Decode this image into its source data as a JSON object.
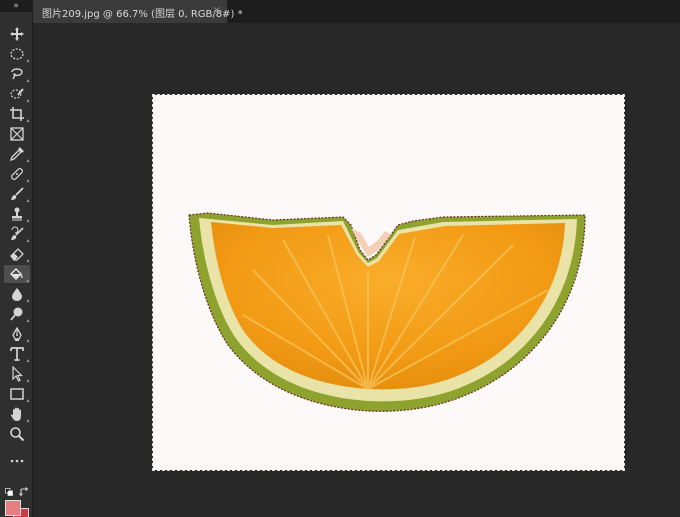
{
  "app": {
    "panel_collapse_glyph": "»"
  },
  "document_tab": {
    "title": "图片209.jpg @ 66.7% (图层 0, RGB/8#) *",
    "close_glyph": "×"
  },
  "toolbar": {
    "tools": [
      {
        "name": "move-tool",
        "icon": "move-icon"
      },
      {
        "name": "marquee-tool",
        "icon": "elliptical-marquee-icon"
      },
      {
        "name": "lasso-tool",
        "icon": "lasso-icon"
      },
      {
        "name": "quick-selection-tool",
        "icon": "quick-selection-icon"
      },
      {
        "name": "crop-tool",
        "icon": "crop-icon"
      },
      {
        "name": "frame-tool",
        "icon": "frame-icon"
      },
      {
        "name": "eyedropper-tool",
        "icon": "eyedropper-icon"
      },
      {
        "name": "healing-brush-tool",
        "icon": "bandage-icon"
      },
      {
        "name": "brush-tool",
        "icon": "brush-icon"
      },
      {
        "name": "clone-stamp-tool",
        "icon": "stamp-icon"
      },
      {
        "name": "history-brush-tool",
        "icon": "history-brush-icon"
      },
      {
        "name": "eraser-tool",
        "icon": "eraser-icon"
      },
      {
        "name": "paint-bucket-tool",
        "icon": "paint-bucket-icon",
        "active": true
      },
      {
        "name": "blur-tool",
        "icon": "drop-icon"
      },
      {
        "name": "dodge-tool",
        "icon": "dodge-icon"
      },
      {
        "name": "pen-tool",
        "icon": "pen-icon"
      },
      {
        "name": "type-tool",
        "icon": "type-icon"
      },
      {
        "name": "path-selection-tool",
        "icon": "arrow-icon"
      },
      {
        "name": "rectangle-tool",
        "icon": "rectangle-icon"
      },
      {
        "name": "hand-tool",
        "icon": "hand-icon"
      },
      {
        "name": "zoom-tool",
        "icon": "zoom-icon"
      },
      {
        "name": "edit-toolbar",
        "icon": "more-icon"
      }
    ],
    "colors": {
      "foreground": "#e57f80",
      "background": "#c83b47"
    }
  },
  "canvas": {
    "background": "#fdf9f8",
    "subject": "orange-slice"
  }
}
